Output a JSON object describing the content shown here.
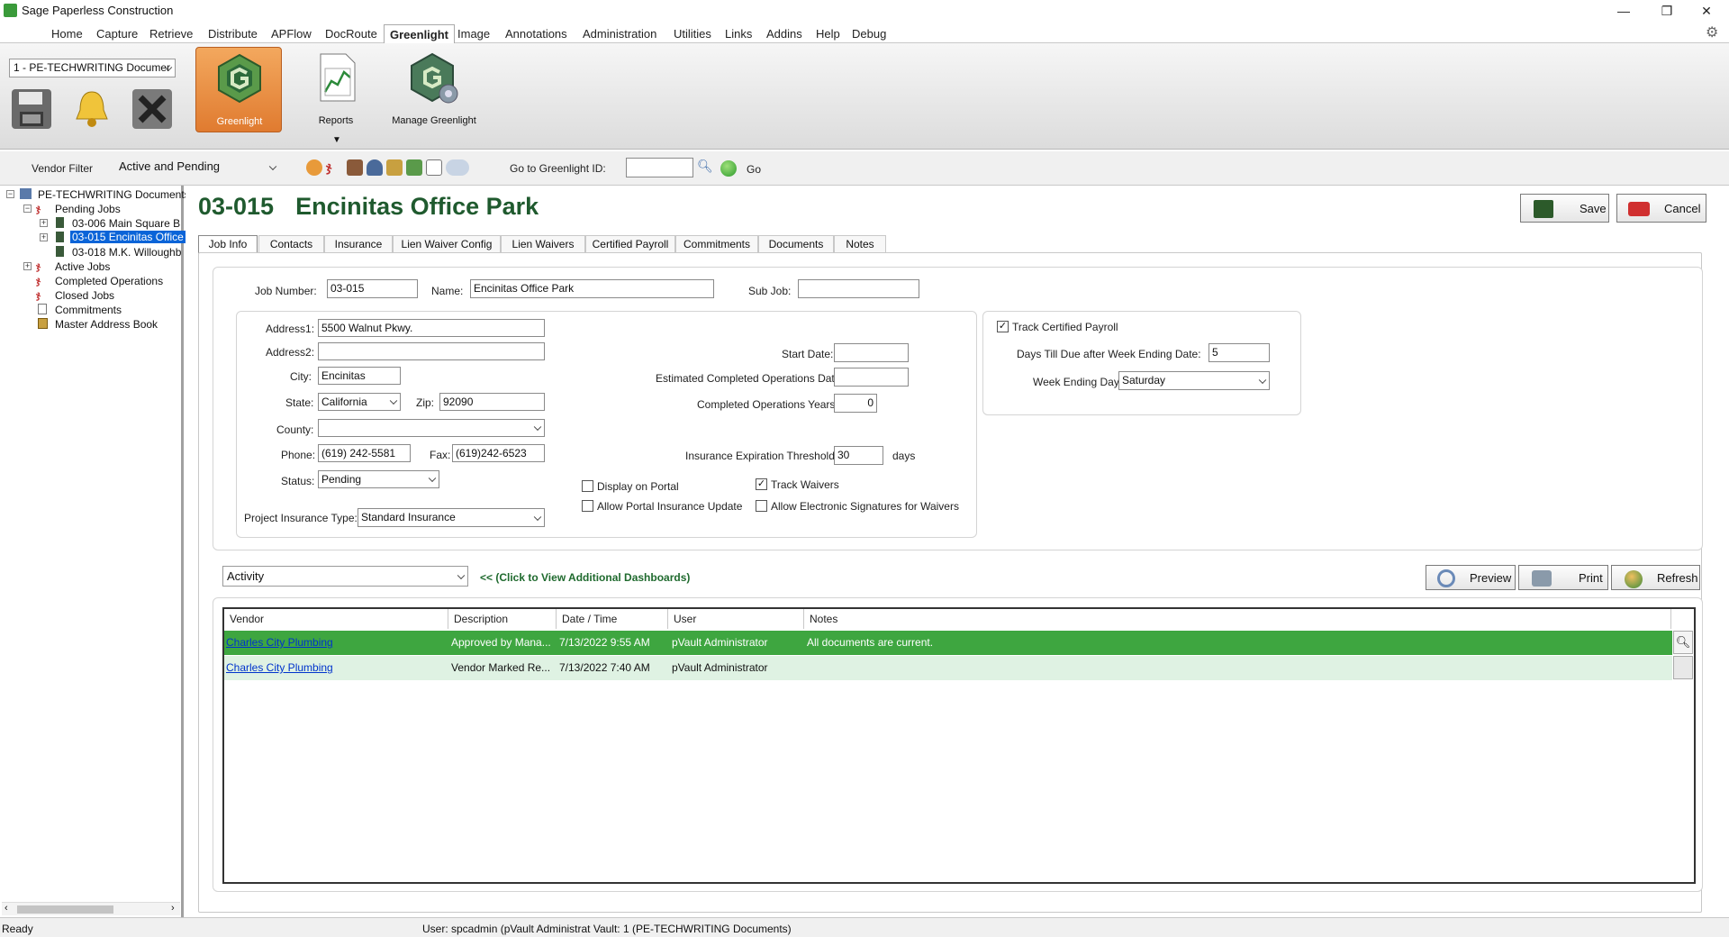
{
  "window": {
    "title": "Sage Paperless Construction",
    "minimize": "—",
    "restore": "❐",
    "close": "✕"
  },
  "menu": [
    "Home",
    "Capture",
    "Retrieve",
    "Distribute",
    "APFlow",
    "DocRoute",
    "Greenlight",
    "Image",
    "Annotations",
    "Administration",
    "Utilities",
    "Links",
    "Addins",
    "Help",
    "Debug"
  ],
  "ribbon": {
    "vault_select": "1 - PE-TECHWRITING Documer",
    "greenlight_label": "Greenlight",
    "reports_label": "Reports",
    "manage_label": "Manage Greenlight",
    "dropdown_marker": "▼"
  },
  "toolbar": {
    "vendor_filter_label": "Vendor Filter",
    "vendor_filter_value": "Active and Pending",
    "goto_label": "Go to Greenlight ID:",
    "goto_value": "",
    "go_label": "Go"
  },
  "tree": {
    "root": "PE-TECHWRITING Documents",
    "pending": "Pending Jobs",
    "job1": "03-006  Main Square B",
    "job2": "03-015  Encinitas Office",
    "job3": "03-018  M.K. Willoughb",
    "active": "Active Jobs",
    "completed": "Completed Operations",
    "closed": "Closed Jobs",
    "commitments": "Commitments",
    "address": "Master Address Book",
    "expand_plus": "+",
    "expand_minus": "−"
  },
  "job": {
    "number": "03-015",
    "name": "Encinitas Office Park"
  },
  "actions": {
    "save": "Save",
    "cancel": "Cancel"
  },
  "tabs": [
    "Job Info",
    "Contacts",
    "Insurance",
    "Lien Waiver Config",
    "Lien Waivers",
    "Certified Payroll",
    "Commitments",
    "Documents",
    "Notes"
  ],
  "form": {
    "job_number_label": "Job Number:",
    "job_number": "03-015",
    "name_label": "Name:",
    "name": "Encinitas Office Park",
    "sub_job_label": "Sub Job:",
    "sub_job": "",
    "address1_label": "Address1:",
    "address1": "5500 Walnut Pkwy.",
    "address2_label": "Address2:",
    "address2": "",
    "city_label": "City:",
    "city": "Encinitas",
    "state_label": "State:",
    "state": "California",
    "zip_label": "Zip:",
    "zip": "92090",
    "county_label": "County:",
    "county": "",
    "phone_label": "Phone:",
    "phone": "(619) 242-5581",
    "fax_label": "Fax:",
    "fax": "(619)242-6523",
    "status_label": "Status:",
    "status": "Pending",
    "project_ins_label": "Project Insurance Type:",
    "project_ins": "Standard Insurance",
    "start_date_label": "Start Date:",
    "start_date": "",
    "est_completed_label": "Estimated Completed Operations Date:",
    "est_completed": "",
    "completed_years_label": "Completed Operations Years:",
    "completed_years": "0",
    "ins_threshold_label": "Insurance Expiration Threshold:",
    "ins_threshold": "30",
    "days_label": "days",
    "display_portal_label": "Display on Portal",
    "display_portal": false,
    "allow_portal_ins_label": "Allow Portal Insurance Update",
    "allow_portal_ins": false,
    "track_waivers_label": "Track Waivers",
    "track_waivers": true,
    "allow_esig_label": "Allow Electronic Signatures for Waivers",
    "allow_esig": false,
    "track_payroll_label": "Track Certified Payroll",
    "track_payroll": true,
    "days_till_due_label": "Days Till Due after Week Ending Date:",
    "days_till_due": "5",
    "week_ending_label": "Week Ending Day:",
    "week_ending": "Saturday",
    "check_mark": "✓"
  },
  "dashboard": {
    "select": "Activity",
    "hint": "<< (Click to View Additional Dashboards)",
    "preview": "Preview",
    "print": "Print",
    "refresh": "Refresh"
  },
  "grid": {
    "headers": [
      "Vendor",
      "Description",
      "Date / Time",
      "User",
      "Notes"
    ],
    "rows": [
      {
        "vendor": "Charles City Plumbing",
        "description": "Approved by Mana...",
        "datetime": "7/13/2022 9:55 AM",
        "user": "pVault Administrator",
        "notes": "All documents are current."
      },
      {
        "vendor": "Charles City Plumbing",
        "description": "Vendor Marked Re...",
        "datetime": "7/13/2022 7:40 AM",
        "user": "pVault Administrator",
        "notes": ""
      }
    ]
  },
  "status": {
    "ready": "Ready",
    "user_info": "User: spcadmin (pVault Administrat  Vault: 1 (PE-TECHWRITING Documents)"
  },
  "colors": {
    "title_green": "#1f5a2e",
    "row_selected": "#3ea640",
    "row_alt": "#dff2e3",
    "greenlight_orange": "#e8893c"
  }
}
